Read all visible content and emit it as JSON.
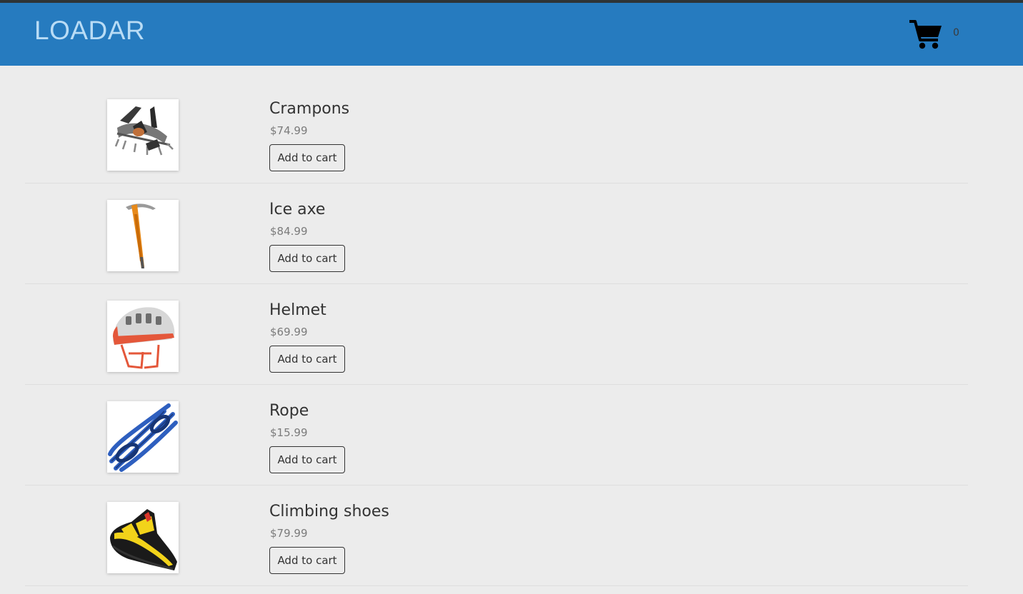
{
  "brand": "LOADAR",
  "cart": {
    "icon": "shopping-cart-icon",
    "count": "0"
  },
  "colors": {
    "header": "#267bbf",
    "background": "#ececec"
  },
  "products": [
    {
      "name": "Crampons",
      "price": "$74.99",
      "button": "Add to cart",
      "icon": "crampons-image"
    },
    {
      "name": "Ice axe",
      "price": "$84.99",
      "button": "Add to cart",
      "icon": "ice-axe-image"
    },
    {
      "name": "Helmet",
      "price": "$69.99",
      "button": "Add to cart",
      "icon": "helmet-image"
    },
    {
      "name": "Rope",
      "price": "$15.99",
      "button": "Add to cart",
      "icon": "rope-image"
    },
    {
      "name": "Climbing shoes",
      "price": "$79.99",
      "button": "Add to cart",
      "icon": "climbing-shoes-image"
    }
  ]
}
